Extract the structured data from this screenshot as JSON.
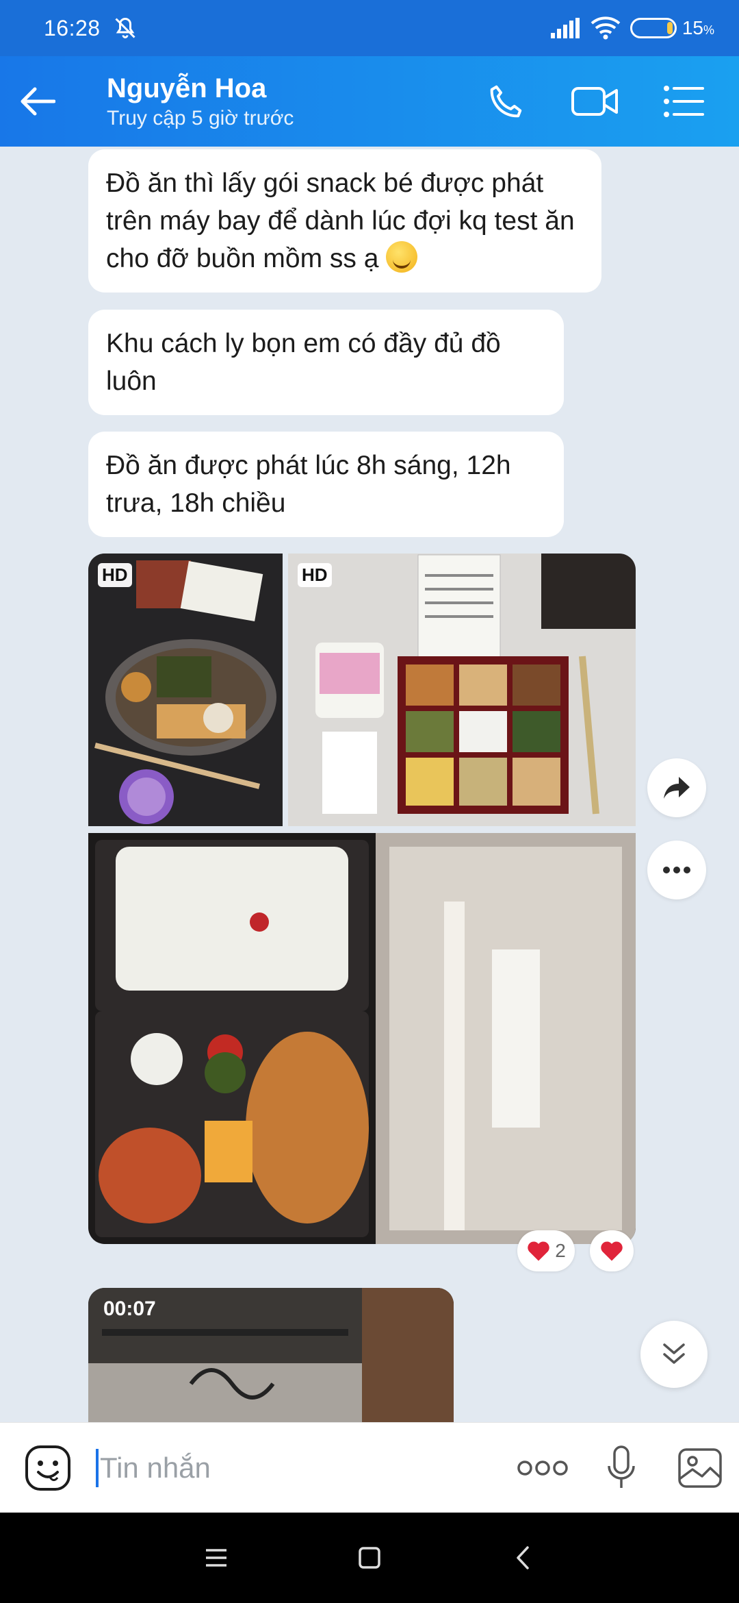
{
  "status_bar": {
    "time": "16:28",
    "battery": "15",
    "battery_unit": "%",
    "battery_level": 0.15
  },
  "header": {
    "contact_name": "Nguyễn Hoa",
    "last_seen": "Truy cập 5 giờ trước",
    "icons": [
      "back-arrow-icon",
      "phone-icon",
      "video-call-icon",
      "menu-list-icon"
    ]
  },
  "messages": [
    {
      "text": "Đồ ăn thì lấy gói snack bé được phát trên máy bay để dành lúc đợi kq test ăn cho đỡ buồn mồm ss ạ",
      "emoji": "rolling-laughing-emoji"
    },
    {
      "text": "Khu cách ly bọn em có đầy đủ đồ luôn"
    },
    {
      "text": "Đồ ăn được phát lúc 8h sáng, 12h trưa, 18h chiều"
    }
  ],
  "photos": {
    "badge": "HD",
    "reaction_count": "2"
  },
  "video": {
    "duration": "00:07"
  },
  "input": {
    "placeholder": "Tin nhắn"
  },
  "colors": {
    "header_start": "#1877e8",
    "header_end": "#1aa0f0",
    "chat_bg": "#e2e9f1",
    "heart": "#e0243a"
  }
}
